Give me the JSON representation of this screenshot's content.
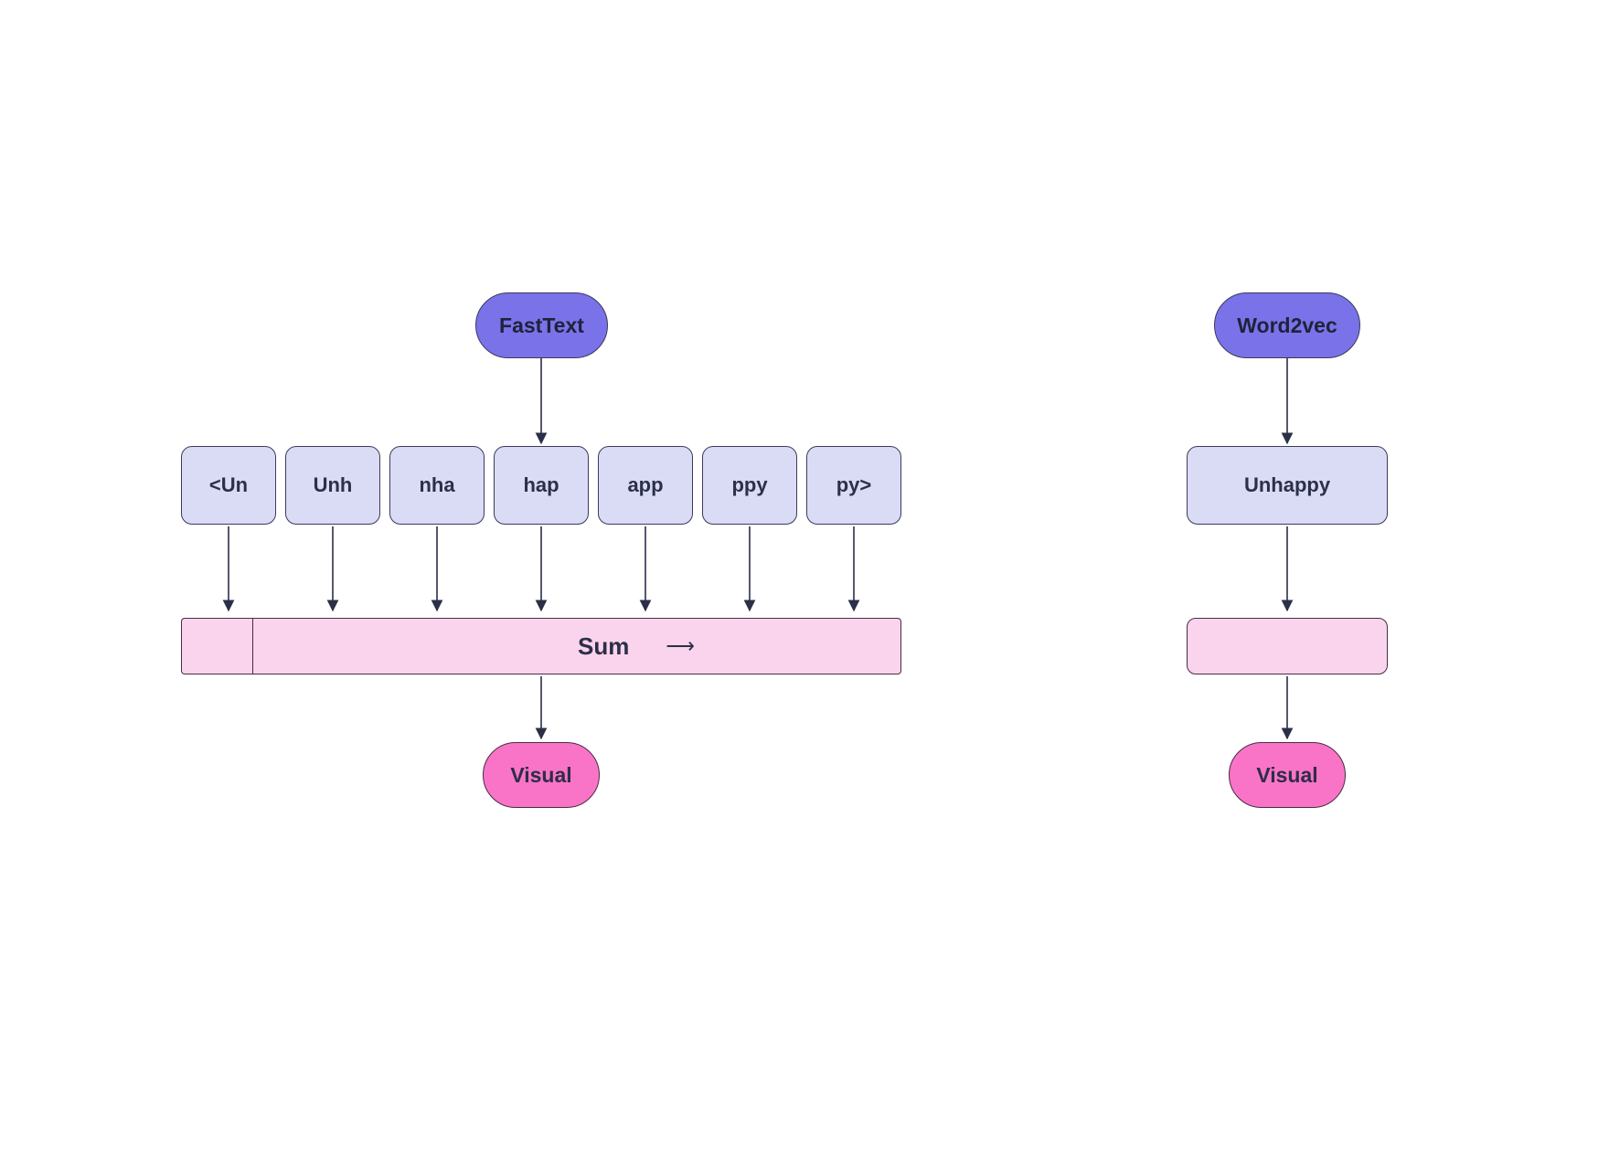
{
  "left": {
    "title": "FastText",
    "ngrams": [
      "<Un",
      "Unh",
      "nha",
      "hap",
      "app",
      "ppy",
      "py>"
    ],
    "sum_label": "Sum",
    "output": "Visual"
  },
  "right": {
    "title": "Word2vec",
    "word": "Unhappy",
    "output": "Visual"
  },
  "colors": {
    "purple": "#7a72e9",
    "lavender": "#dadcf5",
    "pink_light": "#fad4ec",
    "pink": "#f974c7",
    "text": "#2b2f47"
  }
}
